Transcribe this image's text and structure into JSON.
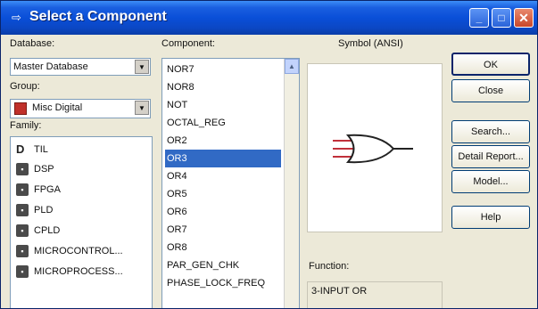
{
  "window": {
    "title": "Select a Component",
    "icon": "multisim-icon"
  },
  "titlebar_buttons": {
    "minimize": "_",
    "maximize": "□",
    "close": "✕"
  },
  "database": {
    "label": "Database:",
    "value": "Master Database"
  },
  "group": {
    "label": "Group:",
    "value": "Misc Digital",
    "icon": "misc-digital-icon"
  },
  "family": {
    "label": "Family:",
    "items": [
      {
        "label": "TIL",
        "icon": "gate-icon"
      },
      {
        "label": "DSP",
        "icon": "chip-icon"
      },
      {
        "label": "FPGA",
        "icon": "chip-icon"
      },
      {
        "label": "PLD",
        "icon": "chip-icon"
      },
      {
        "label": "CPLD",
        "icon": "chip-icon"
      },
      {
        "label": "MICROCONTROL...",
        "icon": "chip-icon"
      },
      {
        "label": "MICROPROCESS...",
        "icon": "chip-icon"
      }
    ]
  },
  "component": {
    "label": "Component:",
    "items": [
      "NOR7",
      "NOR8",
      "NOT",
      "OCTAL_REG",
      "OR2",
      "OR3",
      "OR4",
      "OR5",
      "OR6",
      "OR7",
      "OR8",
      "PAR_GEN_CHK",
      "PHASE_LOCK_FREQ"
    ],
    "selected": "OR3"
  },
  "symbol": {
    "label": "Symbol (ANSI)"
  },
  "function": {
    "label": "Function:",
    "value": "3-INPUT OR"
  },
  "buttons": {
    "ok": "OK",
    "close": "Close",
    "search": "Search...",
    "detail_report": "Detail Report...",
    "model": "Model...",
    "help": "Help"
  }
}
